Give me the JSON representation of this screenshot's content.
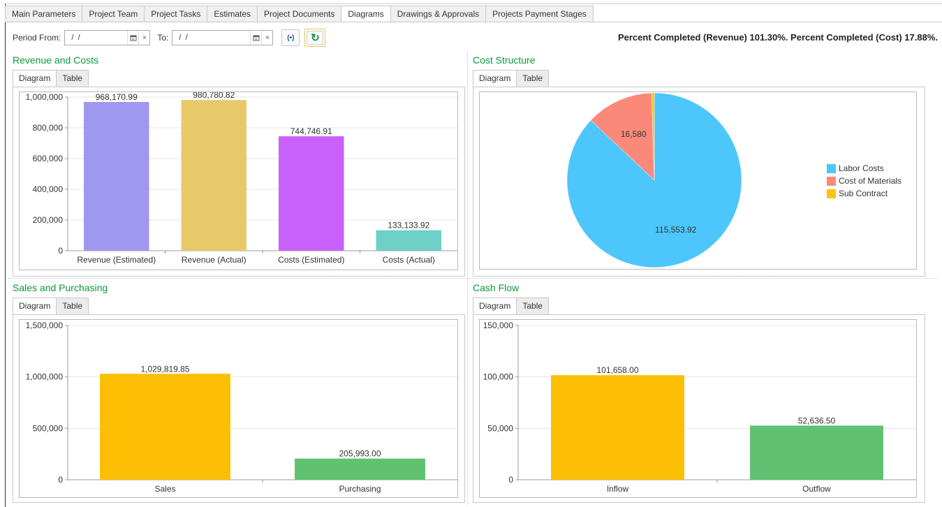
{
  "tabs": [
    "Main Parameters",
    "Project Team",
    "Project Tasks",
    "Estimates",
    "Project Documents",
    "Diagrams",
    "Drawings & Approvals",
    "Projects Payment Stages"
  ],
  "active_tab": "Diagrams",
  "toolbar": {
    "period_from_label": "Period From:",
    "period_from_value": " /  /",
    "to_label": "To:",
    "to_value": " /  /",
    "calendar_icon": "calendar-icon",
    "clear_icon": "×",
    "broadcast_icon": "(•)",
    "refresh_icon": "↻"
  },
  "percent_text": "Percent Completed (Revenue) 101.30%. Percent Completed (Cost) 17.88%.",
  "sections": {
    "revenue": {
      "title": "Revenue and Costs",
      "tab_diagram": "Diagram",
      "tab_table": "Table"
    },
    "cost": {
      "title": "Cost Structure",
      "tab_diagram": "Diagram",
      "tab_table": "Table"
    },
    "sales": {
      "title": "Sales and Purchasing",
      "tab_diagram": "Diagram",
      "tab_table": "Table"
    },
    "cash": {
      "title": "Cash Flow",
      "tab_diagram": "Diagram",
      "tab_table": "Table"
    }
  },
  "colors": {
    "accent_green": "#0b9a3a",
    "rev_est": "#9f98f0",
    "rev_act": "#e8c96a",
    "cost_est": "#c860fc",
    "cost_act": "#6ed0c7",
    "labor": "#4dc6fb",
    "materials": "#fb897a",
    "sub": "#fcc30d",
    "orange": "#fcbf04",
    "green": "#60c170"
  },
  "chart_data": [
    {
      "id": "revenue",
      "type": "bar",
      "categories": [
        "Revenue (Estimated)",
        "Revenue (Actual)",
        "Costs (Estimated)",
        "Costs (Actual)"
      ],
      "values": [
        968170.99,
        980780.82,
        744746.91,
        133133.92
      ],
      "value_labels": [
        "968,170.99",
        "980,780.82",
        "744,746.91",
        "133,133.92"
      ],
      "colors": [
        "#9f98f0",
        "#e8c96a",
        "#c860fc",
        "#6ed0c7"
      ],
      "yticks": [
        "0",
        "200,000",
        "400,000",
        "600,000",
        "800,000",
        "1,000,000"
      ],
      "ylim": [
        0,
        1000000
      ],
      "grid": true
    },
    {
      "id": "cost",
      "type": "pie",
      "labels": [
        "Labor Costs",
        "Cost of Materials",
        "Sub Contract"
      ],
      "values": [
        115553.92,
        16580,
        650
      ],
      "value_labels": [
        "115,553.92",
        "16,580",
        ""
      ],
      "colors": [
        "#4dc6fb",
        "#fb897a",
        "#fcc30d"
      ],
      "legend": "right"
    },
    {
      "id": "sales",
      "type": "bar",
      "categories": [
        "Sales",
        "Purchasing"
      ],
      "values": [
        1029819.85,
        205993.0
      ],
      "value_labels": [
        "1,029,819.85",
        "205,993.00"
      ],
      "colors": [
        "#fcbf04",
        "#60c170"
      ],
      "yticks": [
        "0",
        "500,000",
        "1,000,000",
        "1,500,000"
      ],
      "ylim": [
        0,
        1500000
      ],
      "grid": true
    },
    {
      "id": "cash",
      "type": "bar",
      "categories": [
        "Inflow",
        "Outflow"
      ],
      "values": [
        101658.0,
        52636.5
      ],
      "value_labels": [
        "101,658.00",
        "52,636.50"
      ],
      "colors": [
        "#fcbf04",
        "#60c170"
      ],
      "yticks": [
        "0",
        "50,000",
        "100,000",
        "150,000"
      ],
      "ylim": [
        0,
        150000
      ],
      "grid": true
    }
  ]
}
